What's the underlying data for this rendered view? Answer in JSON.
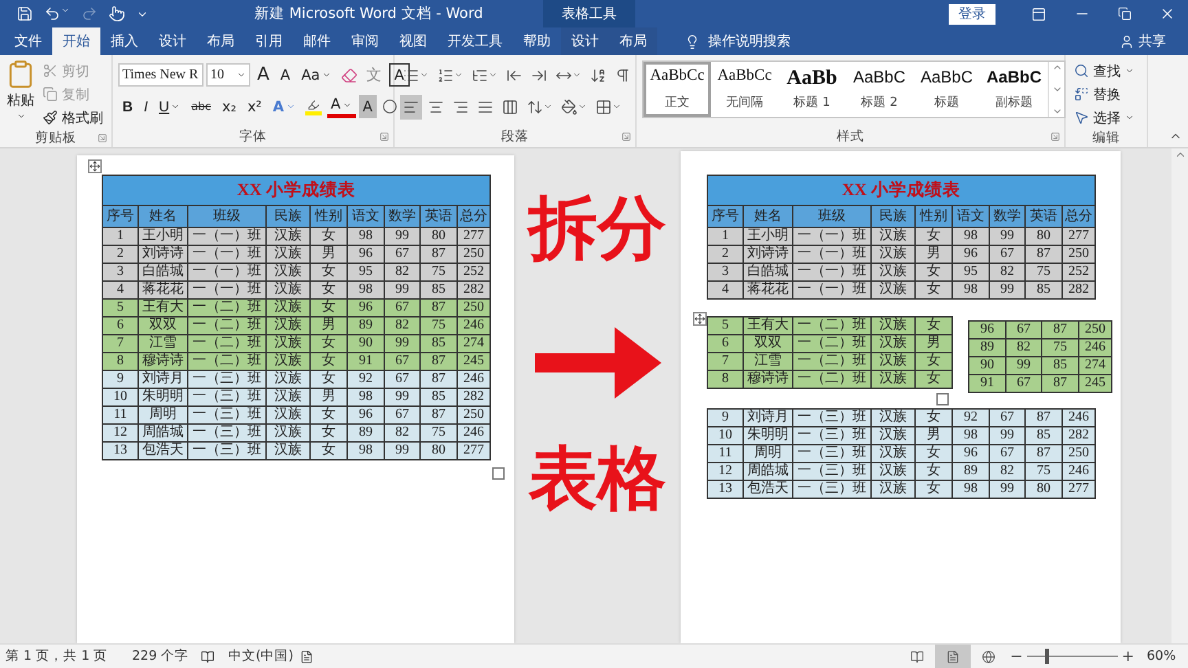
{
  "window": {
    "title": "新建 Microsoft Word 文档 - Word",
    "context_group": "表格工具",
    "sign_in": "登录"
  },
  "quick_access": {
    "redo": {
      "disabled": true
    }
  },
  "tabs": [
    {
      "label": "文件",
      "selected": false
    },
    {
      "label": "开始",
      "selected": true
    },
    {
      "label": "插入",
      "selected": false
    },
    {
      "label": "设计",
      "selected": false
    },
    {
      "label": "布局",
      "selected": false
    },
    {
      "label": "引用",
      "selected": false
    },
    {
      "label": "邮件",
      "selected": false
    },
    {
      "label": "审阅",
      "selected": false
    },
    {
      "label": "视图",
      "selected": false
    },
    {
      "label": "开发工具",
      "selected": false
    },
    {
      "label": "帮助",
      "selected": false
    }
  ],
  "context_tabs": [
    {
      "label": "设计",
      "selected": false
    },
    {
      "label": "布局",
      "selected": false
    }
  ],
  "tell_me": "操作说明搜索",
  "share": "共享",
  "clipboard": {
    "label": "剪贴板",
    "paste": "粘贴",
    "items": [
      {
        "kind": "cut",
        "label": "剪切",
        "disabled": true
      },
      {
        "kind": "copy",
        "label": "复制",
        "disabled": true
      },
      {
        "kind": "painter",
        "label": "格式刷",
        "disabled": false
      }
    ]
  },
  "font": {
    "label": "字体",
    "font_name": "Times New R",
    "font_size": "10",
    "row1": [
      {
        "kind": "grow",
        "text": "A"
      },
      {
        "kind": "shrink",
        "text": "A"
      },
      {
        "kind": "case",
        "text": "Aa"
      },
      {
        "kind": "clear"
      },
      {
        "kind": "phonetic",
        "text": "文"
      },
      {
        "kind": "border",
        "text": "A"
      }
    ],
    "row2": [
      {
        "kind": "bold",
        "text": "B"
      },
      {
        "kind": "italic",
        "text": "I"
      },
      {
        "kind": "underline",
        "text": "U"
      },
      {
        "kind": "strike",
        "text": "abc"
      },
      {
        "kind": "sub",
        "text": "x₂"
      },
      {
        "kind": "sup",
        "text": "x²"
      },
      {
        "kind": "effect",
        "text": "A"
      },
      {
        "kind": "highlight"
      },
      {
        "kind": "color",
        "text": "A"
      },
      {
        "kind": "shading",
        "text": "A"
      },
      {
        "kind": "enclose"
      }
    ]
  },
  "paragraph": {
    "label": "段落",
    "alignment": [
      {
        "selected": true
      },
      {
        "selected": false
      },
      {
        "selected": false
      },
      {
        "selected": false
      },
      {
        "selected": false
      }
    ]
  },
  "styles": {
    "label": "样式",
    "items": [
      {
        "kind": "normal",
        "preview": "AaBbCc",
        "label": "正文",
        "selected": true
      },
      {
        "kind": "no_spacing",
        "preview": "AaBbCc",
        "label": "无间隔",
        "selected": false
      },
      {
        "kind": "heading1",
        "preview": "AaBb",
        "label": "标题 1",
        "selected": false
      },
      {
        "kind": "heading2",
        "preview": "AaBbC",
        "label": "标题 2",
        "selected": false
      },
      {
        "kind": "title",
        "preview": "AaBbC",
        "label": "标题",
        "selected": false
      },
      {
        "kind": "subtitle",
        "preview": "AaBbC",
        "label": "副标题",
        "selected": false
      }
    ]
  },
  "editing": {
    "label": "编辑",
    "items": [
      {
        "kind": "find",
        "label": "查找"
      },
      {
        "kind": "replace",
        "label": "替换"
      },
      {
        "kind": "select",
        "label": "选择"
      }
    ]
  },
  "left_table": {
    "title": "XX 小学成绩表",
    "columns": [
      "序号",
      "姓名",
      "班级",
      "民族",
      "性别",
      "语文",
      "数学",
      "英语",
      "总分"
    ],
    "rows": [
      {
        "color": "#cfcfcf",
        "cells": [
          "1",
          "王小明",
          "一（一）班",
          "汉族",
          "女",
          "98",
          "99",
          "80",
          "277"
        ]
      },
      {
        "color": "#cfcfcf",
        "cells": [
          "2",
          "刘诗诗",
          "一（一）班",
          "汉族",
          "男",
          "96",
          "67",
          "87",
          "250"
        ]
      },
      {
        "color": "#cfcfcf",
        "cells": [
          "3",
          "白皓城",
          "一（一）班",
          "汉族",
          "女",
          "95",
          "82",
          "75",
          "252"
        ]
      },
      {
        "color": "#cfcfcf",
        "cells": [
          "4",
          "蒋花花",
          "一（一）班",
          "汉族",
          "女",
          "98",
          "99",
          "85",
          "282"
        ]
      },
      {
        "color": "#a9d08e",
        "cells": [
          "5",
          "王有大",
          "一（二）班",
          "汉族",
          "女",
          "96",
          "67",
          "87",
          "250"
        ]
      },
      {
        "color": "#a9d08e",
        "cells": [
          "6",
          "双双",
          "一（二）班",
          "汉族",
          "男",
          "89",
          "82",
          "75",
          "246"
        ]
      },
      {
        "color": "#a9d08e",
        "cells": [
          "7",
          "江雪",
          "一（二）班",
          "汉族",
          "女",
          "90",
          "99",
          "85",
          "274"
        ]
      },
      {
        "color": "#a9d08e",
        "cells": [
          "8",
          "穆诗诗",
          "一（二）班",
          "汉族",
          "女",
          "91",
          "67",
          "87",
          "245"
        ]
      },
      {
        "color": "#d4e6ee",
        "cells": [
          "9",
          "刘诗月",
          "一（三）班",
          "汉族",
          "女",
          "92",
          "67",
          "87",
          "246"
        ]
      },
      {
        "color": "#d4e6ee",
        "cells": [
          "10",
          "朱明明",
          "一（三）班",
          "汉族",
          "男",
          "98",
          "99",
          "85",
          "282"
        ]
      },
      {
        "color": "#d4e6ee",
        "cells": [
          "11",
          "周明",
          "一（三）班",
          "汉族",
          "女",
          "96",
          "67",
          "87",
          "250"
        ]
      },
      {
        "color": "#d4e6ee",
        "cells": [
          "12",
          "周皓城",
          "一（三）班",
          "汉族",
          "女",
          "89",
          "82",
          "75",
          "246"
        ]
      },
      {
        "color": "#d4e6ee",
        "cells": [
          "13",
          "包浩天",
          "一（三）班",
          "汉族",
          "女",
          "98",
          "99",
          "80",
          "277"
        ]
      }
    ]
  },
  "annotation": {
    "top": "拆分",
    "bottom": "表格"
  },
  "right_table": {
    "title": "XX 小学成绩表",
    "columns": [
      "序号",
      "姓名",
      "班级",
      "民族",
      "性别",
      "语文",
      "数学",
      "英语",
      "总分"
    ],
    "top_rows": [
      {
        "color": "#cfcfcf",
        "cells": [
          "1",
          "王小明",
          "一（一）班",
          "汉族",
          "女",
          "98",
          "99",
          "80",
          "277"
        ]
      },
      {
        "color": "#cfcfcf",
        "cells": [
          "2",
          "刘诗诗",
          "一（一）班",
          "汉族",
          "男",
          "96",
          "67",
          "87",
          "250"
        ]
      },
      {
        "color": "#cfcfcf",
        "cells": [
          "3",
          "白皓城",
          "一（一）班",
          "汉族",
          "女",
          "95",
          "82",
          "75",
          "252"
        ]
      },
      {
        "color": "#cfcfcf",
        "cells": [
          "4",
          "蒋花花",
          "一（一）班",
          "汉族",
          "女",
          "98",
          "99",
          "85",
          "282"
        ]
      }
    ],
    "split_left_rows": [
      {
        "color": "#a9d08e",
        "cells": [
          "5",
          "王有大",
          "一（二）班",
          "汉族",
          "女"
        ]
      },
      {
        "color": "#a9d08e",
        "cells": [
          "6",
          "双双",
          "一（二）班",
          "汉族",
          "男"
        ]
      },
      {
        "color": "#a9d08e",
        "cells": [
          "7",
          "江雪",
          "一（二）班",
          "汉族",
          "女"
        ]
      },
      {
        "color": "#a9d08e",
        "cells": [
          "8",
          "穆诗诗",
          "一（二）班",
          "汉族",
          "女"
        ]
      }
    ],
    "split_right_rows": [
      {
        "color": "#a9d08e",
        "cells": [
          "96",
          "67",
          "87",
          "250"
        ]
      },
      {
        "color": "#a9d08e",
        "cells": [
          "89",
          "82",
          "75",
          "246"
        ]
      },
      {
        "color": "#a9d08e",
        "cells": [
          "90",
          "99",
          "85",
          "274"
        ]
      },
      {
        "color": "#a9d08e",
        "cells": [
          "91",
          "67",
          "87",
          "245"
        ]
      }
    ],
    "bottom_rows": [
      {
        "color": "#d4e6ee",
        "cells": [
          "9",
          "刘诗月",
          "一（三）班",
          "汉族",
          "女",
          "92",
          "67",
          "87",
          "246"
        ]
      },
      {
        "color": "#d4e6ee",
        "cells": [
          "10",
          "朱明明",
          "一（三）班",
          "汉族",
          "男",
          "98",
          "99",
          "85",
          "282"
        ]
      },
      {
        "color": "#d4e6ee",
        "cells": [
          "11",
          "周明",
          "一（三）班",
          "汉族",
          "女",
          "96",
          "67",
          "87",
          "250"
        ]
      },
      {
        "color": "#d4e6ee",
        "cells": [
          "12",
          "周皓城",
          "一（三）班",
          "汉族",
          "女",
          "89",
          "82",
          "75",
          "246"
        ]
      },
      {
        "color": "#d4e6ee",
        "cells": [
          "13",
          "包浩天",
          "一（三）班",
          "汉族",
          "女",
          "98",
          "99",
          "80",
          "277"
        ]
      }
    ]
  },
  "status_bar": {
    "page": "第 1 页，共 1 页",
    "words": "229 个字",
    "language": "中文(中国)",
    "views": [
      {
        "selected": false
      },
      {
        "selected": true
      },
      {
        "selected": false
      }
    ],
    "zoom": {
      "minus": "−",
      "plus": "+",
      "level": 0.2,
      "reading": "60%"
    }
  }
}
